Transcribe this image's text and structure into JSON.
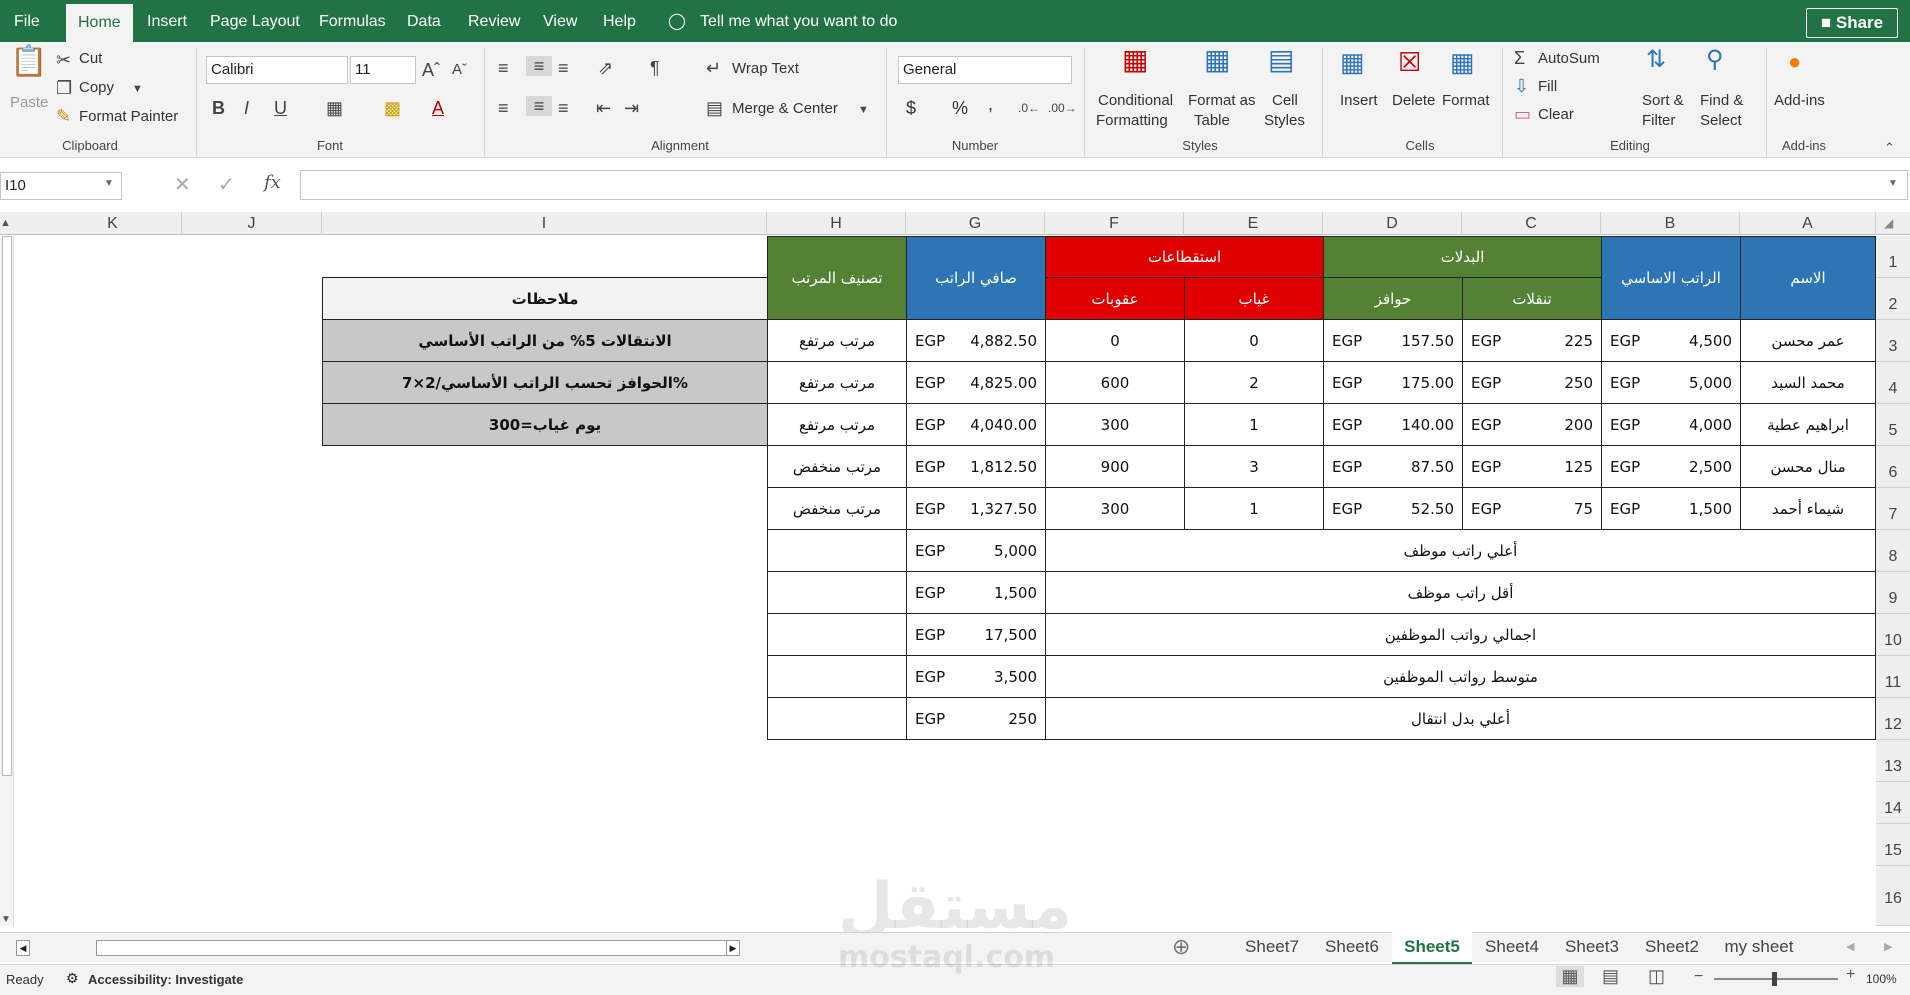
{
  "ribbon_tabs": [
    "File",
    "Home",
    "Insert",
    "Page Layout",
    "Formulas",
    "Data",
    "Review",
    "View",
    "Help"
  ],
  "tell_me": "Tell me what you want to do",
  "share": "Share",
  "clipboard": {
    "paste": "Paste",
    "cut": "Cut",
    "copy": "Copy",
    "format_painter": "Format Painter",
    "group": "Clipboard"
  },
  "font": {
    "name": "Calibri",
    "size": "11",
    "group": "Font"
  },
  "alignment": {
    "wrap": "Wrap Text",
    "merge": "Merge & Center",
    "group": "Alignment"
  },
  "number": {
    "format": "General",
    "currency": "$",
    "percent": "%",
    "comma": ",",
    "group": "Number"
  },
  "styles": {
    "cond1": "Conditional",
    "cond2": "Formatting",
    "fat1": "Format as",
    "fat2": "Table",
    "cs1": "Cell",
    "cs2": "Styles",
    "group": "Styles"
  },
  "cells": {
    "insert": "Insert",
    "delete": "Delete",
    "format": "Format",
    "group": "Cells"
  },
  "editing": {
    "autosum": "AutoSum",
    "fill": "Fill",
    "clear": "Clear",
    "sort1": "Sort &",
    "sort2": "Filter",
    "find1": "Find &",
    "find2": "Select",
    "group": "Editing"
  },
  "addins": {
    "label": "Add-ins",
    "group": "Add-ins"
  },
  "name_box": "I10",
  "fx": "fx",
  "columns": [
    "K",
    "J",
    "I",
    "H",
    "G",
    "F",
    "E",
    "D",
    "C",
    "B",
    "A"
  ],
  "rows": [
    "1",
    "2",
    "3",
    "4",
    "5",
    "6",
    "7",
    "8",
    "9",
    "10",
    "11",
    "12",
    "13",
    "14",
    "15",
    "16"
  ],
  "table": {
    "h_name": "الاسم",
    "h_basic": "الراتب الاساسي",
    "h_allow": "البدلات",
    "h_trans": "تنقلات",
    "h_incent": "حوافز",
    "h_deduct": "استقطاعات",
    "h_absent": "غياب",
    "h_penal": "عقوبات",
    "h_net": "صافي الراتب",
    "h_class": "تصنيف المرتب",
    "currency": "EGP",
    "rows": [
      {
        "name": "عمر محسن",
        "basic": "4,500",
        "trans": "225",
        "incent": "157.50",
        "absent": "0",
        "penal": "0",
        "net": "4,882.50",
        "cls": "مرتب مرتفع"
      },
      {
        "name": "محمد السيد",
        "basic": "5,000",
        "trans": "250",
        "incent": "175.00",
        "absent": "2",
        "penal": "600",
        "net": "4,825.00",
        "cls": "مرتب مرتفع"
      },
      {
        "name": "ابراهيم عطية",
        "basic": "4,000",
        "trans": "200",
        "incent": "140.00",
        "absent": "1",
        "penal": "300",
        "net": "4,040.00",
        "cls": "مرتب مرتفع"
      },
      {
        "name": "منال محسن",
        "basic": "2,500",
        "trans": "125",
        "incent": "87.50",
        "absent": "3",
        "penal": "900",
        "net": "1,812.50",
        "cls": "مرتب منخفض"
      },
      {
        "name": "شيماء أحمد",
        "basic": "1,500",
        "trans": "75",
        "incent": "52.50",
        "absent": "1",
        "penal": "300",
        "net": "1,327.50",
        "cls": "مرتب منخفض"
      }
    ],
    "summary": [
      {
        "label": "أعلي راتب موظف",
        "value": "5,000"
      },
      {
        "label": "أقل راتب موظف",
        "value": "1,500"
      },
      {
        "label": "اجمالي رواتب الموظفين",
        "value": "17,500"
      },
      {
        "label": "متوسط رواتب الموظفين",
        "value": "3,500"
      },
      {
        "label": "أعلي بدل انتقال",
        "value": "250"
      }
    ]
  },
  "notes": {
    "title": "ملاحظات",
    "n1": "الانتقالات 5% من الراتب الأساسي",
    "n2": "الحوافز تحسب الراتب الأساسي/2×7%",
    "n3": "يوم غياب=300"
  },
  "sheets": [
    "Sheet7",
    "Sheet6",
    "Sheet5",
    "Sheet4",
    "Sheet3",
    "Sheet2",
    "my sheet"
  ],
  "active_sheet": "Sheet5",
  "status": {
    "ready": "Ready",
    "access": "Accessibility: Investigate",
    "zoom": "100%"
  },
  "watermark": {
    "ar": "مستقل",
    "en": "mostaql.com"
  },
  "colors": {
    "excel_green": "#217346",
    "blue": "#2e75b6",
    "green": "#548235",
    "red": "#e00000"
  }
}
